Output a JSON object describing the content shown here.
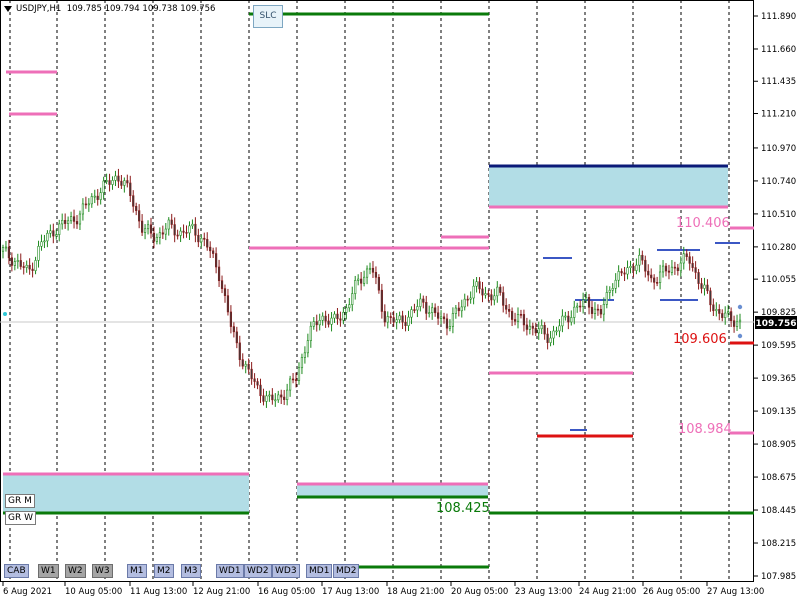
{
  "header": {
    "symbol": "USDJPY,H1",
    "ohlc": "109.785 109.794 109.738 109.756"
  },
  "chart_data": {
    "type": "candlestick",
    "y_axis_labels": [
      "111.890",
      "111.660",
      "111.435",
      "111.210",
      "110.970",
      "110.740",
      "110.510",
      "110.280",
      "110.055",
      "109.825",
      "109.595",
      "109.365",
      "109.135",
      "108.905",
      "108.675",
      "108.445",
      "108.215",
      "107.985"
    ],
    "current_price": "109.756",
    "x_axis_labels": [
      "6 Aug 2021",
      "10 Aug 05:00",
      "11 Aug 13:00",
      "12 Aug 21:00",
      "16 Aug 05:00",
      "17 Aug 13:00",
      "18 Aug 21:00",
      "20 Aug 05:00",
      "23 Aug 13:00",
      "24 Aug 21:00",
      "26 Aug 05:00",
      "27 Aug 13:00"
    ],
    "price_trend": [
      110.25,
      110.18,
      110.1,
      110.3,
      110.4,
      110.45,
      110.5,
      110.62,
      110.7,
      110.78,
      110.65,
      110.4,
      110.35,
      110.42,
      110.38,
      110.4,
      110.3,
      110.1,
      109.7,
      109.45,
      109.3,
      109.2,
      109.25,
      109.35,
      109.65,
      109.8,
      109.75,
      109.85,
      110.05,
      110.15,
      109.8,
      109.75,
      109.8,
      109.9,
      109.8,
      109.75,
      109.85,
      110.0,
      109.95,
      109.95,
      109.8,
      109.75,
      109.7,
      109.65,
      109.75,
      109.85,
      109.9,
      109.8,
      110.05,
      110.1,
      110.2,
      110.05,
      110.1,
      110.15,
      110.2,
      110.0,
      109.85,
      109.78,
      109.76
    ],
    "level_labels": {
      "a": "110.406",
      "b": "109.606",
      "c": "108.984",
      "d": "108.425"
    },
    "colors": {
      "pink": "#ee6fb8",
      "green": "#0a7a0a",
      "red": "#dd1111",
      "navy": "#0b1a78",
      "zone": "#b2dde6",
      "candle": "#1e8a1e"
    }
  },
  "buttons": {
    "slc": "SLC",
    "gr_m": "GR M",
    "gr_w": "GR W",
    "cab": "CAB",
    "w1": "W1",
    "w2": "W2",
    "w3": "W3",
    "m1": "M1",
    "m2": "M2",
    "m3": "M3",
    "wd1": "WD1",
    "wd2": "WD2",
    "wd3": "WD3",
    "md1": "MD1",
    "md2": "MD2"
  }
}
